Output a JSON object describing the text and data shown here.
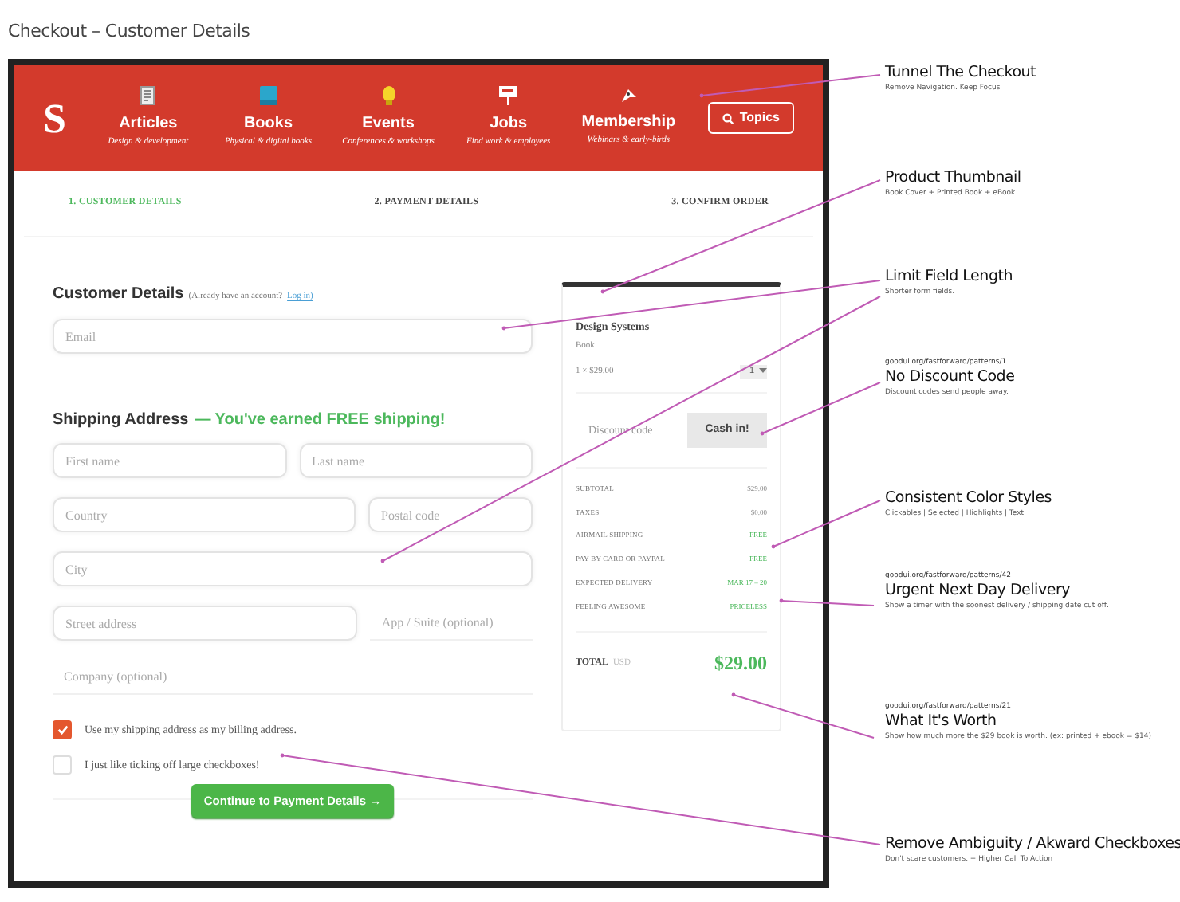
{
  "page_title": "Checkout – Customer Details",
  "header": {
    "logo": "S",
    "nav": [
      {
        "label": "Articles",
        "sub": "Design & development"
      },
      {
        "label": "Books",
        "sub": "Physical & digital books"
      },
      {
        "label": "Events",
        "sub": "Conferences & workshops"
      },
      {
        "label": "Jobs",
        "sub": "Find work & employees"
      },
      {
        "label": "Membership",
        "sub": "Webinars & early-birds"
      }
    ],
    "topics_button": "Topics"
  },
  "steps": [
    {
      "label": "1. CUSTOMER DETAILS",
      "selected": true
    },
    {
      "label": "2. PAYMENT DETAILS",
      "selected": false
    },
    {
      "label": "3. CONFIRM ORDER",
      "selected": false
    }
  ],
  "customer_details": {
    "heading": "Customer Details",
    "note": "(Already have an account?",
    "link": "Log in)",
    "email": {
      "placeholder": "Email"
    }
  },
  "shipping": {
    "heading": "Shipping Address",
    "promo": "— You've earned FREE shipping!",
    "rows": [
      [
        {
          "placeholder": "First name",
          "kind": "boxed"
        },
        {
          "placeholder": "Last name",
          "kind": "boxed"
        }
      ],
      [
        {
          "placeholder": "Country",
          "kind": "boxed"
        },
        {
          "placeholder": "Postal code",
          "kind": "boxed"
        }
      ],
      [
        {
          "placeholder": "City",
          "kind": "boxed"
        }
      ],
      [
        {
          "placeholder": "Street address",
          "kind": "boxed"
        },
        {
          "placeholder": "App / Suite (optional)",
          "kind": "plain"
        }
      ],
      [
        {
          "placeholder": "Company (optional)",
          "kind": "plain"
        }
      ]
    ]
  },
  "checkboxes": [
    {
      "label": "Use my shipping address as my billing address.",
      "checked": true
    },
    {
      "label": "I just like ticking off large checkboxes!",
      "checked": false
    }
  ],
  "continue_button": "Continue to Payment Details →",
  "order": {
    "product": "Design Systems",
    "type": "Book",
    "price": "1 × $29.00",
    "quantity": "1",
    "discount": {
      "placeholder": "Discount code",
      "button": "Cash in!"
    },
    "summary": [
      {
        "label": "SUBTOTAL",
        "value": "$29.00",
        "highlight": false
      },
      {
        "label": "TAXES",
        "value": "$0.00",
        "highlight": false
      },
      {
        "label": "AIRMAIL SHIPPING",
        "value": "FREE",
        "highlight": true
      },
      {
        "label": "PAY BY CARD OR PAYPAL",
        "value": "FREE",
        "highlight": true
      },
      {
        "label": "EXPECTED DELIVERY",
        "value": "MAR 17 – 20",
        "highlight": true
      },
      {
        "label": "FEELING AWESOME",
        "value": "PRICELESS",
        "highlight": true
      }
    ],
    "total_label": "TOTAL",
    "currency": "USD",
    "total": "$29.00"
  },
  "annotations": [
    {
      "title": "Tunnel The Checkout",
      "text": "Remove Navigation. Keep Focus"
    },
    {
      "title": "Product Thumbnail",
      "text": "Book Cover + Printed Book + eBook"
    },
    {
      "title": "Limit Field Length",
      "text": "Shorter form fields."
    },
    {
      "url": "goodui.org/fastforward/patterns/1",
      "title": "No Discount Code",
      "text": "Discount codes send people away."
    },
    {
      "title": "Consistent Color Styles",
      "text": "Clickables | Selected | Highlights | Text"
    },
    {
      "url": "goodui.org/fastforward/patterns/42",
      "title": "Urgent Next Day Delivery",
      "text": "Show a timer with the soonest delivery / shipping date cut off."
    },
    {
      "url": "goodui.org/fastforward/patterns/21",
      "title": "What It's Worth",
      "text": "Show how much more the $29 book is worth. (ex: printed + ebook = $14)"
    },
    {
      "title": "Remove Ambiguity / Akward Checkboxes",
      "text": "Don't scare customers. + Higher Call To Action"
    }
  ]
}
